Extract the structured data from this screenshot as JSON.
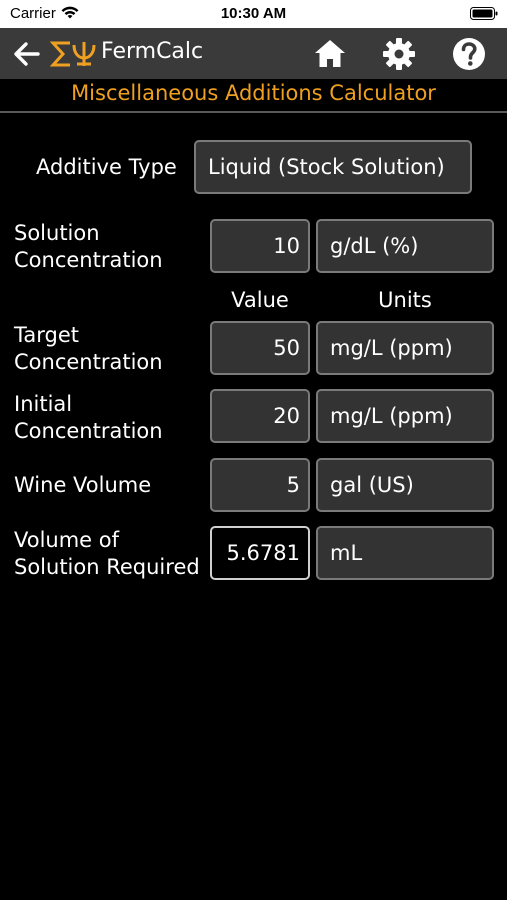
{
  "status_bar": {
    "carrier": "Carrier",
    "time": "10:30 AM"
  },
  "nav": {
    "app_name": "FermCalc",
    "icons": [
      "back-arrow-icon",
      "fermcalc-logo-icon",
      "home-icon",
      "gear-icon",
      "help-icon"
    ]
  },
  "page": {
    "title": "Miscellaneous Additions Calculator"
  },
  "additive": {
    "label": "Additive Type",
    "value": "Liquid (Stock Solution)"
  },
  "solution_concentration": {
    "label_line1": "Solution",
    "label_line2": "Concentration",
    "value": "10",
    "units": "g/dL (%)"
  },
  "columns": {
    "value": "Value",
    "units": "Units"
  },
  "target_concentration": {
    "label_line1": "Target",
    "label_line2": "Concentration",
    "value": "50",
    "units": "mg/L (ppm)"
  },
  "initial_concentration": {
    "label_line1": "Initial",
    "label_line2": "Concentration",
    "value": "20",
    "units": "mg/L (ppm)"
  },
  "wine_volume": {
    "label": "Wine Volume",
    "value": "5",
    "units": "gal (US)"
  },
  "volume_required": {
    "label_line1": "Volume of",
    "label_line2": "Solution Required",
    "value": "5.6781",
    "units": "mL"
  },
  "colors": {
    "title_accent": "#f0a020",
    "nav_background": "#3a3a3a",
    "field_background": "#333333",
    "page_background": "#000000"
  }
}
